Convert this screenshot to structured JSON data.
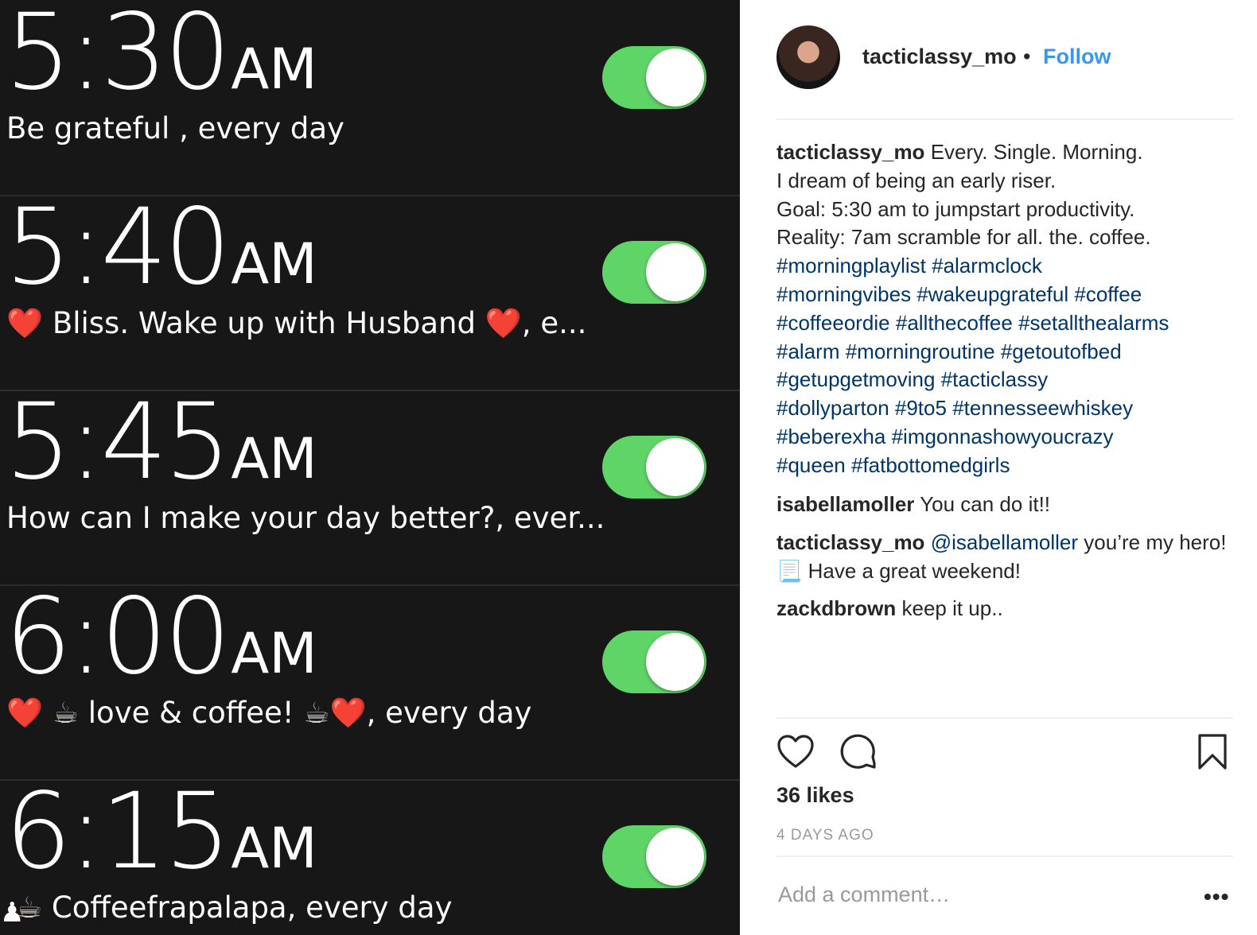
{
  "photo": {
    "alarms": [
      {
        "time": "5:30",
        "ampm": "AM",
        "label_text": "Be grateful , every day",
        "enabled": true
      },
      {
        "time": "5:40",
        "ampm": "AM",
        "label_pre": "❤️",
        "label_text": " Bliss. Wake up with Husband ",
        "label_post": "❤️",
        "label_tail": ", e...",
        "enabled": true
      },
      {
        "time": "5:45",
        "ampm": "AM",
        "label_text": "How can I make your day better?, ever...",
        "enabled": true
      },
      {
        "time": "6:00",
        "ampm": "AM",
        "label_pre": "❤️",
        "cup1": "☕",
        "label_text": " love & coffee! ",
        "cup2": "☕",
        "label_post": "❤️",
        "label_tail": ", every day",
        "enabled": true
      },
      {
        "time": "6:15",
        "ampm": "AM",
        "cup1": "☕",
        "label_text": " Coffeefrapalapa, every day",
        "enabled": true
      }
    ],
    "switch_color": "#5fd568"
  },
  "post": {
    "username": "tacticlassy_mo",
    "separator": "•",
    "follow_label": "Follow",
    "caption": {
      "username": "tacticlassy_mo",
      "lines": [
        "Every. Single. Morning.",
        "I dream of being an early riser.",
        "Goal: 5:30 am to jumpstart productivity.",
        "Reality: 7am scramble for all. the. coffee."
      ],
      "hashtags": [
        "#morningplaylist",
        "#alarmclock",
        "#morningvibes",
        "#wakeupgrateful",
        "#coffee",
        "#coffeeordie",
        "#allthecoffee",
        "#setallthealarms",
        "#alarm",
        "#morningroutine",
        "#getoutofbed",
        "#getupgetmoving",
        "#tacticlassy",
        "#dollyparton",
        "#9to5",
        "#tennesseewhiskey",
        "#beberexha",
        "#imgonnashowyoucrazy",
        "#queen",
        "#fatbottomedgirls"
      ]
    },
    "comments": [
      {
        "username": "isabellamoller",
        "text": "You can do it!!"
      },
      {
        "username": "tacticlassy_mo",
        "mention": "@isabellamoller",
        "text": "you’re my hero! 📃 Have a great weekend!"
      },
      {
        "username": "zackdbrown",
        "text": "keep it up.."
      }
    ],
    "likes": "36 likes",
    "time_ago": "4 DAYS AGO",
    "add_comment_placeholder": "Add a comment…",
    "more_label": "•••",
    "icons": {
      "like": "heart-icon",
      "comment": "comment-icon",
      "save": "bookmark-icon",
      "more": "more-icon"
    },
    "colors": {
      "link_blue": "#3897f0",
      "hashtag": "#003569",
      "text": "#262626",
      "muted": "#999999"
    }
  }
}
